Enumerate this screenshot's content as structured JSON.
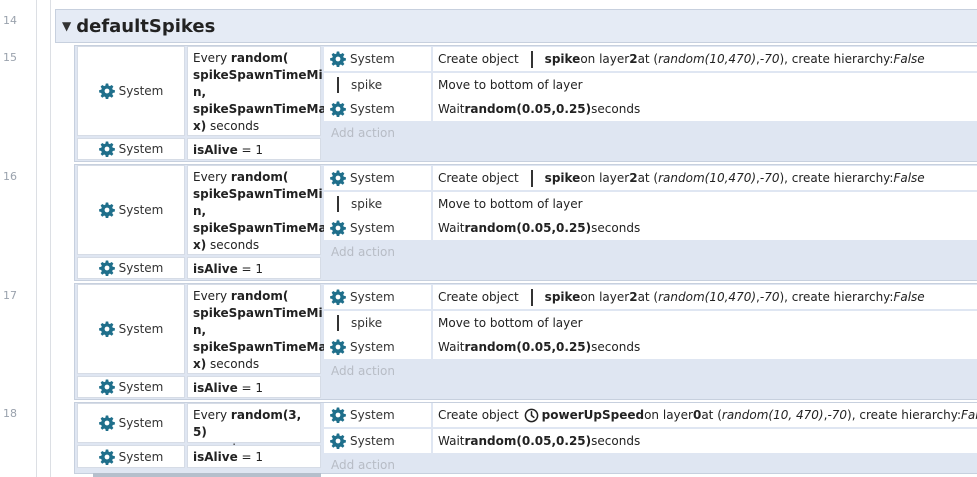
{
  "line_numbers": [
    "14",
    "15",
    "16",
    "17",
    "18"
  ],
  "group": {
    "name": "defaultSpikes",
    "collapse_icon": "triangle-down-icon"
  },
  "colors": {
    "gear": "#1f6f8b",
    "group_header": "#e5ebf5",
    "event_bg": "#dfe6f2",
    "add_action": "#b7bcc5"
  },
  "labels": {
    "system": "System",
    "add_action": "Add action"
  },
  "spike_event": {
    "every_prefix": "Every ",
    "every_fn": "random(",
    "every_arg1_a": "spikeSpawnTimeMi",
    "every_arg1_b": "n,",
    "every_arg2_a": "spikeSpawnTimeMa",
    "every_arg2_b": "x)",
    "every_suffix": " seconds",
    "alive_var": "isAlive",
    "alive_rest": " = 1",
    "create_label": "Create object",
    "create_obj": "spike",
    "create_layer_pre": " on layer ",
    "create_layer": "2",
    "create_at": " at (",
    "create_x": "random(10,470)",
    "create_comma": ", ",
    "create_y": "-70",
    "create_hier": "), create hierarchy: ",
    "create_false": "False",
    "move_obj": "spike",
    "move_label": "Move to bottom of layer",
    "wait_label": "Wait ",
    "wait_value": "random(0.05,0.25)",
    "wait_suffix": " seconds"
  },
  "powerup_event": {
    "every_prefix": "Every ",
    "every_fn": "random(3, 5)",
    "every_suffix": "seconds",
    "alive_var": "isAlive",
    "alive_rest": " = 1",
    "create_label": "Create object",
    "create_obj": "powerUpSpeed",
    "create_layer_pre": " on layer ",
    "create_layer": "0",
    "create_at": " at (",
    "create_x": "random(10, 470)",
    "create_comma": ", ",
    "create_y": "-70",
    "create_hier": "), create hierarchy: ",
    "create_false": "False",
    "wait_label": "Wait ",
    "wait_value": "random(0.05,0.25)",
    "wait_suffix": " seconds"
  }
}
